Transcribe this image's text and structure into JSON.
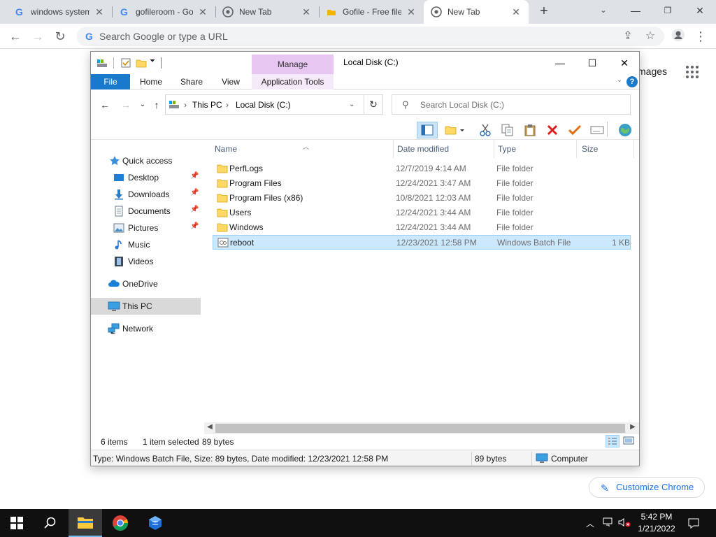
{
  "browser": {
    "tabs": [
      {
        "title": "windows system",
        "icon": "google-icon"
      },
      {
        "title": "gofileroom - Go",
        "icon": "google-icon"
      },
      {
        "title": "New Tab",
        "icon": "chrome-icon"
      },
      {
        "title": "Gofile - Free file",
        "icon": "gofile-icon"
      },
      {
        "title": "New Tab",
        "icon": "chrome-icon",
        "active": true
      }
    ],
    "omnibox_placeholder": "Search Google or type a URL",
    "ntp_images_link": "mages",
    "customize_label": "Customize Chrome"
  },
  "explorer": {
    "window_title": "Local Disk (C:)",
    "contextual_group": "Manage",
    "ribbon_tabs": [
      "File",
      "Home",
      "Share",
      "View",
      "Application Tools"
    ],
    "breadcrumb": [
      "This PC",
      "Local Disk (C:)"
    ],
    "search_placeholder": "Search Local Disk (C:)",
    "nav": {
      "quick_access": "Quick access",
      "pinned": [
        "Desktop",
        "Downloads",
        "Documents",
        "Pictures"
      ],
      "others": [
        "Music",
        "Videos"
      ],
      "onedrive": "OneDrive",
      "this_pc": "This PC",
      "network": "Network"
    },
    "columns": {
      "name": "Name",
      "date": "Date modified",
      "type": "Type",
      "size": "Size"
    },
    "files": [
      {
        "name": "PerfLogs",
        "date": "12/7/2019 4:14 AM",
        "type": "File folder",
        "size": "",
        "kind": "folder"
      },
      {
        "name": "Program Files",
        "date": "12/24/2021 3:47 AM",
        "type": "File folder",
        "size": "",
        "kind": "folder"
      },
      {
        "name": "Program Files (x86)",
        "date": "10/8/2021 12:03 AM",
        "type": "File folder",
        "size": "",
        "kind": "folder"
      },
      {
        "name": "Users",
        "date": "12/24/2021 3:44 AM",
        "type": "File folder",
        "size": "",
        "kind": "folder"
      },
      {
        "name": "Windows",
        "date": "12/24/2021 3:44 AM",
        "type": "File folder",
        "size": "",
        "kind": "folder"
      },
      {
        "name": "reboot",
        "date": "12/23/2021 12:58 PM",
        "type": "Windows Batch File",
        "size": "1 KB",
        "kind": "batch",
        "selected": true
      }
    ],
    "status": {
      "count": "6 items",
      "selected": "1 item selected",
      "bytes": "89 bytes"
    },
    "details": {
      "info": "Type: Windows Batch File, Size: 89 bytes, Date modified: 12/23/2021 12:58 PM",
      "size": "89 bytes",
      "location": "Computer"
    }
  },
  "taskbar": {
    "time": "5:42 PM",
    "date": "1/21/2022"
  },
  "colors": {
    "accent_blue": "#1979ca",
    "manage_band": "#e8c6f2",
    "selection": "#cce8ff",
    "taskbar": "#101010"
  }
}
